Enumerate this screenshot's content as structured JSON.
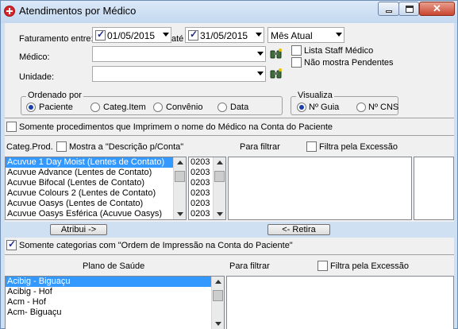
{
  "window": {
    "title": "Atendimentos por Médico",
    "min_label": "",
    "max_label": "",
    "close_label": "✕"
  },
  "filters": {
    "faturamento_label": "Faturamento entre:",
    "date_from": "01/05/2015",
    "ate_label": "até",
    "date_to": "31/05/2015",
    "period_select": "Mês Atual",
    "medico_label": "Médico:",
    "medico_value": "",
    "unidade_label": "Unidade:",
    "unidade_value": "",
    "lista_staff_label": "Lista Staff Médico",
    "nao_mostra_label": "Não mostra Pendentes"
  },
  "ordenado": {
    "legend": "Ordenado por",
    "options": [
      "Paciente",
      "Categ.Item",
      "Convênio",
      "Data"
    ],
    "selected": "Paciente"
  },
  "visualiza": {
    "legend": "Visualiza",
    "options": [
      "Nº Guia",
      "Nº CNS"
    ],
    "selected": "Nº Guia"
  },
  "somente_procedimentos_label": "Somente procedimentos que Imprimem o nome do Médico na Conta do Paciente",
  "categ_section": {
    "categ_prod_label": "Categ.Prod.",
    "mostra_descricao_label": "Mostra a \"Descrição p/Conta\"",
    "para_filtrar_label": "Para filtrar",
    "filtra_excecao_label": "Filtra pela Excessão",
    "items": [
      {
        "name": "Acuvue 1 Day Moist (Lentes de Contato)",
        "code": "0203",
        "selected": true
      },
      {
        "name": "Acuvue Advance (Lentes de Contato)",
        "code": "0203",
        "selected": false
      },
      {
        "name": "Acuvue Bifocal (Lentes de Contato)",
        "code": "0203",
        "selected": false
      },
      {
        "name": "Acuvue Colours 2 (Lentes de Contato)",
        "code": "0203",
        "selected": false
      },
      {
        "name": "Acuvue Oasys (Lentes de Contato)",
        "code": "0203",
        "selected": false
      },
      {
        "name": "Acuvue Oasys Esférica (Acuvue Oasys)",
        "code": "0203",
        "selected": false
      }
    ],
    "atribui_label": "Atribui ->",
    "retira_label": "<- Retira"
  },
  "somente_categorias_label": "Somente categorias com \"Ordem de Impressão na Conta do Paciente\"",
  "plano_section": {
    "plano_label": "Plano de Saúde",
    "para_filtrar_label": "Para filtrar",
    "filtra_excecao_label": "Filtra pela Excessão",
    "items": [
      {
        "name": "Acibig - Biguaçu",
        "selected": true
      },
      {
        "name": "Acibig - Hof",
        "selected": false
      },
      {
        "name": "Acm - Hof",
        "selected": false
      },
      {
        "name": "Acm- Biguaçu",
        "selected": false
      }
    ]
  }
}
